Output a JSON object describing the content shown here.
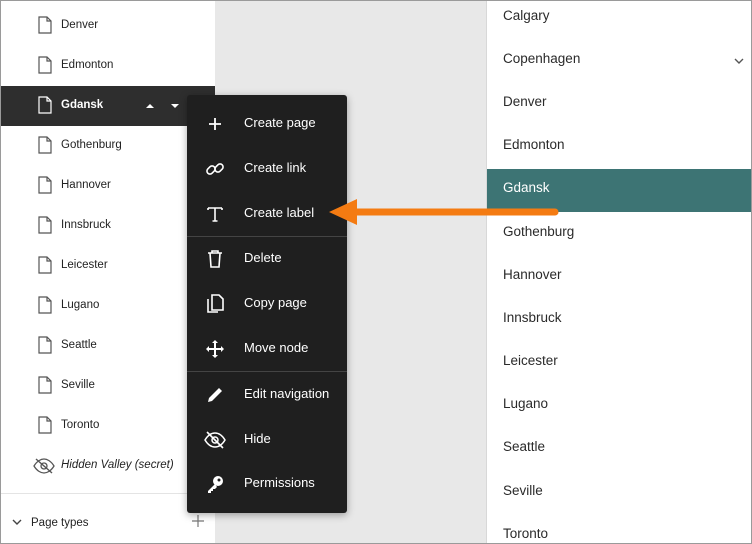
{
  "tree": {
    "items": [
      {
        "label": "Denver"
      },
      {
        "label": "Edmonton"
      },
      {
        "label": "Gdansk"
      },
      {
        "label": "Gothenburg"
      },
      {
        "label": "Hannover"
      },
      {
        "label": "Innsbruck"
      },
      {
        "label": "Leicester"
      },
      {
        "label": "Lugano"
      },
      {
        "label": "Seattle"
      },
      {
        "label": "Seville"
      },
      {
        "label": "Toronto"
      }
    ],
    "hidden_item": {
      "label": "Hidden Valley (secret)"
    },
    "page_types_label": "Page types"
  },
  "context_menu": {
    "items": [
      {
        "label": "Create page",
        "icon": "plus-icon"
      },
      {
        "label": "Create link",
        "icon": "link-icon"
      },
      {
        "label": "Create label",
        "icon": "text-icon"
      },
      {
        "label": "Delete",
        "icon": "trash-icon"
      },
      {
        "label": "Copy page",
        "icon": "copy-icon"
      },
      {
        "label": "Move node",
        "icon": "move-icon"
      },
      {
        "label": "Edit navigation",
        "icon": "pencil-icon"
      },
      {
        "label": "Hide",
        "icon": "eye-off-icon"
      },
      {
        "label": "Permissions",
        "icon": "key-icon"
      }
    ]
  },
  "right_list": {
    "items": [
      {
        "label": "Calgary"
      },
      {
        "label": "Copenhagen"
      },
      {
        "label": "Denver"
      },
      {
        "label": "Edmonton"
      },
      {
        "label": "Gdansk"
      },
      {
        "label": "Gothenburg"
      },
      {
        "label": "Hannover"
      },
      {
        "label": "Innsbruck"
      },
      {
        "label": "Leicester"
      },
      {
        "label": "Lugano"
      },
      {
        "label": "Seattle"
      },
      {
        "label": "Seville"
      },
      {
        "label": "Toronto"
      }
    ],
    "selected_index": 4
  },
  "colors": {
    "selected_row": "#3d7474",
    "active_tree": "#2e2e2e",
    "menu_bg": "#1f1f1f",
    "annotation_arrow": "#f47b12"
  }
}
